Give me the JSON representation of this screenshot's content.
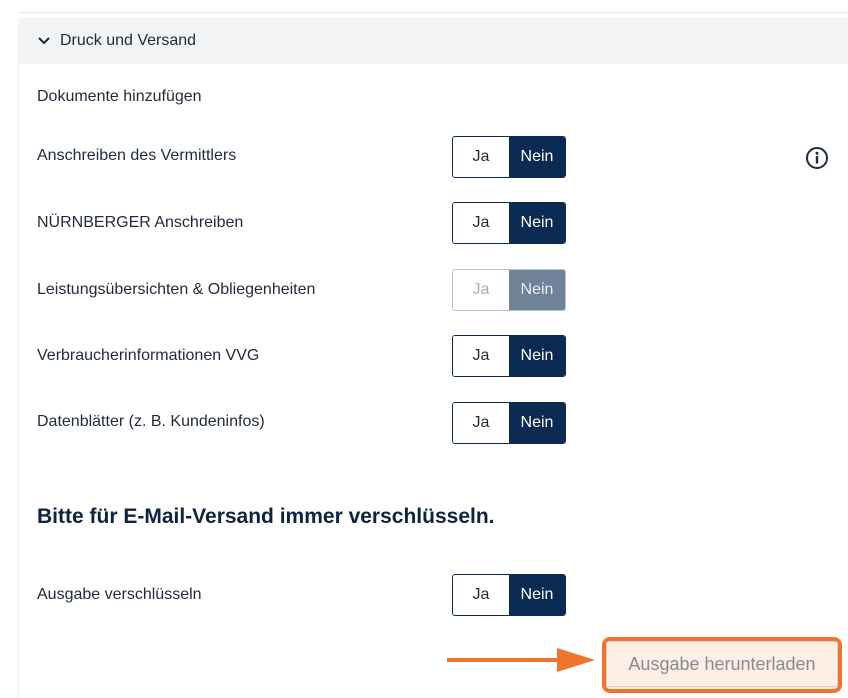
{
  "section": {
    "title": "Druck und Versand"
  },
  "documents": {
    "heading": "Dokumente hinzufügen",
    "rows": [
      {
        "label": "Anschreiben des Vermittlers",
        "yes": "Ja",
        "no": "Nein",
        "selected": "Nein",
        "disabled": false
      },
      {
        "label": "NÜRNBERGER Anschreiben",
        "yes": "Ja",
        "no": "Nein",
        "selected": "Nein",
        "disabled": false
      },
      {
        "label": "Leistungsübersichten & Obliegenheiten",
        "yes": "Ja",
        "no": "Nein",
        "selected": "Nein",
        "disabled": true
      },
      {
        "label": "Verbraucherinformationen VVG",
        "yes": "Ja",
        "no": "Nein",
        "selected": "Nein",
        "disabled": false
      },
      {
        "label": "Datenblätter (z. B. Kundeninfos)",
        "yes": "Ja",
        "no": "Nein",
        "selected": "Nein",
        "disabled": false
      }
    ]
  },
  "encryption": {
    "heading": "Bitte für E-Mail-Versand immer verschlüsseln.",
    "label": "Ausgabe verschlüsseln",
    "yes": "Ja",
    "no": "Nein",
    "selected": "Nein"
  },
  "download": {
    "label": "Ausgabe herunterladen"
  },
  "colors": {
    "primary": "#0b2a52",
    "disabled": "#6f8299",
    "highlight": "#f0742e"
  },
  "icons": {
    "section_toggle": "chevron-down-icon",
    "info": "info-icon",
    "annotation": "arrow-right-icon"
  }
}
